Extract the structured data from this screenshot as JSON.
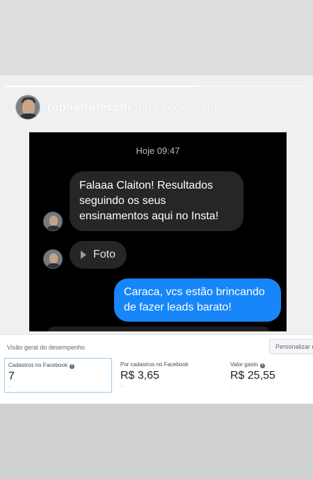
{
  "story": {
    "progress": 0.63,
    "username": "raphafrateschi",
    "meta": "para você",
    "time": "6 min"
  },
  "chat": {
    "date": "Hoje 09:47",
    "messages": [
      {
        "from": "them",
        "text": "Falaaa Claiton! Resultados seguindo os seus ensinamentos aqui no Insta!"
      },
      {
        "from": "them",
        "text": "Foto"
      },
      {
        "from": "me",
        "text": "Caraca, vcs estão brincando de fazer leads barato!"
      }
    ]
  },
  "performance": {
    "title": "Visão geral do desempenho",
    "customize_label": "Personalizar métricas",
    "metrics": [
      {
        "label": "Cadastros no Facebook",
        "value": "7",
        "sub": "--"
      },
      {
        "label": "Por cadastros no Facebook",
        "value": "R$ 3,65",
        "sub": "--"
      },
      {
        "label": "Valor gasto",
        "value": "R$ 25,55",
        "sub": "--"
      }
    ]
  },
  "colors": {
    "outgoing_bubble": "#1786f8",
    "incoming_bubble": "#262626",
    "chat_background": "#000000"
  },
  "icons": {
    "info": "info-icon",
    "play": "play-icon"
  }
}
